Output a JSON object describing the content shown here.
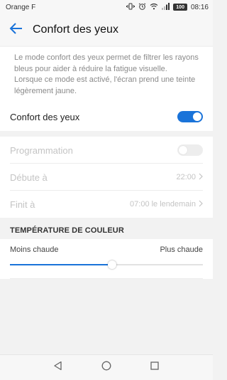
{
  "status_bar": {
    "carrier": "Orange F",
    "battery": "100",
    "time": "08:16"
  },
  "app_bar": {
    "title": "Confort des yeux",
    "back_icon": "arrow-left-icon"
  },
  "description": {
    "lines": [
      "Le mode confort des yeux permet de filtrer les rayons",
      "bleus pour aider à réduire la fatigue visuelle.",
      "Lorsque ce mode est activé, l'écran prend une teinte",
      "légèrement jaune."
    ]
  },
  "eye_comfort": {
    "label": "Confort des yeux",
    "enabled": true
  },
  "schedule": {
    "label": "Programmation",
    "enabled": false,
    "start_label": "Débute à",
    "start_value": "22:00",
    "end_label": "Finit à",
    "end_value": "07:00 le lendemain"
  },
  "color_temperature": {
    "section_title": "TEMPÉRATURE DE COULEUR",
    "min_label": "Moins chaude",
    "max_label": "Plus chaude",
    "value_percent": 53
  },
  "colors": {
    "accent": "#1a73d9",
    "disabled_text": "#c4c4c4",
    "background": "#f2f2f2"
  },
  "nav_bar": {
    "icons": [
      "back-triangle-icon",
      "home-circle-icon",
      "recents-square-icon"
    ]
  }
}
